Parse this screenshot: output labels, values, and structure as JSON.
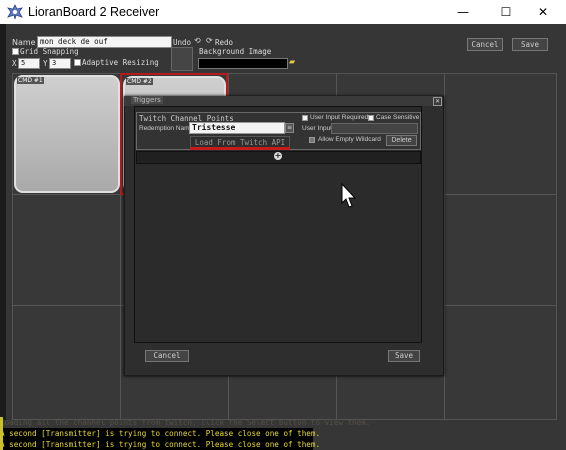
{
  "window": {
    "title": "LioranBoard 2 Receiver",
    "minimize_glyph": "—",
    "maximize_glyph": "☐",
    "close_glyph": "✕"
  },
  "toolbar": {
    "name_label": "Name",
    "name_value": "mon deck de ouf",
    "undo_label": "Undo",
    "redo_label": "Redo",
    "grid_snapping_label": "Grid Snapping",
    "x_label": "X",
    "x_value": "5",
    "y_label": "Y",
    "y_value": "3",
    "adaptive_resizing_label": "Adaptive Resizing",
    "background_image_label": "Background Image",
    "cancel_label": "Cancel",
    "save_label": "Save"
  },
  "deck": {
    "tiles": [
      "CMD #1",
      "CMD #2"
    ]
  },
  "triggers_dialog": {
    "title": "Triggers",
    "close_glyph": "✕",
    "section_title": "Twitch Channel Points",
    "redemption_name_label": "Redemption Name",
    "redemption_name_value": "Tristesse",
    "load_button_label": "Load From Twitch API",
    "user_input_required_label": "User Input Required",
    "case_sensitive_label": "Case Sensitive",
    "user_input_label": "User Input",
    "allow_empty_wildcard_label": "Allow Empty Wildcard",
    "delete_label": "Delete",
    "add_glyph": "+",
    "cancel_label": "Cancel",
    "save_label": "Save"
  },
  "console": {
    "lines": [
      "Loading all the channel points from twitch, click the Select button to view them.",
      "A second [Transmitter] is trying to connect. Please close one of them.",
      "A second [Transmitter] is trying to connect. Please close one of them."
    ]
  },
  "icons": [
    "app-logo-icon",
    "undo-icon",
    "redo-icon",
    "folder-icon",
    "list-icon",
    "add-icon",
    "mouse-cursor-icon"
  ],
  "colors": {
    "highlight_red": "#c31c1c",
    "console_yellow": "#e9dc2a",
    "console_bg": "#000000"
  }
}
